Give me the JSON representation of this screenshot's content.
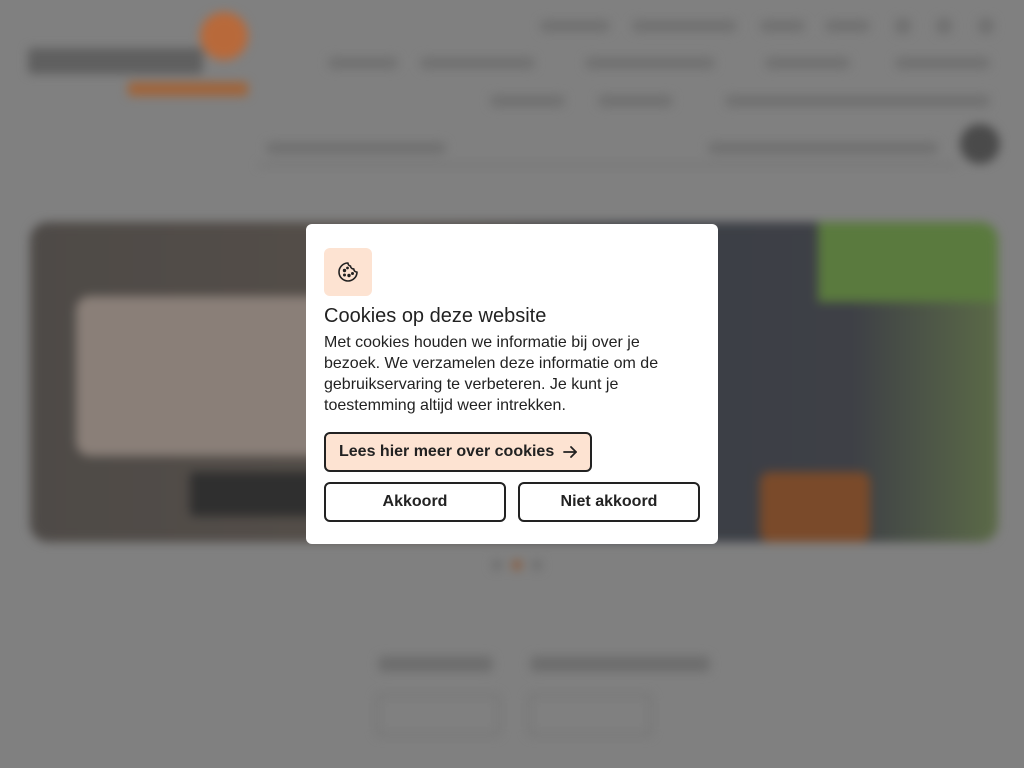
{
  "modal": {
    "title": "Cookies op deze website",
    "body": "Met cookies houden we informatie bij over je bezoek. We verzamelen deze informatie om de gebruikservaring te verbeteren. Je kunt je toestemming altijd weer intrekken.",
    "more_label": "Lees hier meer over cookies",
    "accept_label": "Akkoord",
    "decline_label": "Niet akkoord",
    "icon": "cookie-icon",
    "more_icon": "arrow-right-icon"
  },
  "colors": {
    "accent_light": "#fde3d2",
    "border": "#222222",
    "backdrop": "#808080"
  }
}
